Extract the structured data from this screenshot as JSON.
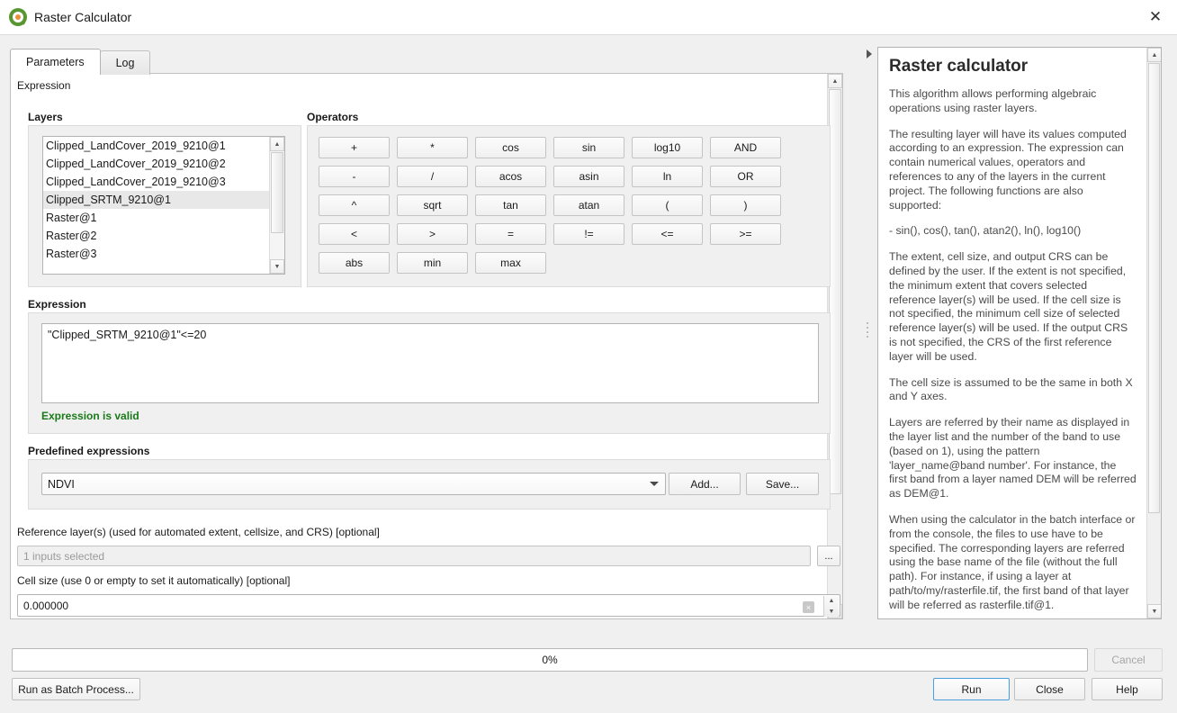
{
  "window": {
    "title": "Raster Calculator",
    "logo_icon": "qgis-logo-icon",
    "close_icon": "✕"
  },
  "tabs": [
    {
      "label": "Parameters",
      "active": true
    },
    {
      "label": "Log",
      "active": false
    }
  ],
  "section_headers": {
    "expression_section": "Expression",
    "layers": "Layers",
    "operators": "Operators",
    "expression": "Expression",
    "predefined": "Predefined expressions"
  },
  "layers": {
    "items": [
      {
        "label": "Clipped_LandCover_2019_9210@1",
        "selected": false
      },
      {
        "label": "Clipped_LandCover_2019_9210@2",
        "selected": false
      },
      {
        "label": "Clipped_LandCover_2019_9210@3",
        "selected": false
      },
      {
        "label": "Clipped_SRTM_9210@1",
        "selected": true
      },
      {
        "label": "Raster@1",
        "selected": false
      },
      {
        "label": "Raster@2",
        "selected": false
      },
      {
        "label": "Raster@3",
        "selected": false
      }
    ]
  },
  "operators": {
    "rows": [
      [
        "+",
        "*",
        "cos",
        "sin",
        "log10",
        "AND"
      ],
      [
        "-",
        "/",
        "acos",
        "asin",
        "ln",
        "OR"
      ],
      [
        "^",
        "sqrt",
        "tan",
        "atan",
        "(",
        ")"
      ],
      [
        "<",
        ">",
        "=",
        "!=",
        "<=",
        ">="
      ],
      [
        "abs",
        "min",
        "max"
      ]
    ]
  },
  "expression": {
    "value": "\"Clipped_SRTM_9210@1\"<=20",
    "validation_text": "Expression is valid",
    "validation_color": "#1a7a1a"
  },
  "predefined": {
    "selected": "NDVI",
    "add_label": "Add...",
    "save_label": "Save..."
  },
  "reference_layers": {
    "label": "Reference layer(s) (used for automated extent, cellsize, and CRS) [optional]",
    "value": "1 inputs selected",
    "browse_label": "..."
  },
  "cell_size": {
    "label": "Cell size (use 0 or empty to set it automatically) [optional]",
    "value": "0.000000",
    "clear_icon": "⌧"
  },
  "help": {
    "title": "Raster calculator",
    "paragraphs": [
      "This algorithm allows performing algebraic operations using raster layers.",
      "The resulting layer will have its values computed according to an expression. The expression can contain numerical values, operators and references to any of the layers in the current project. The following functions are also supported:",
      "- sin(), cos(), tan(), atan2(), ln(), log10()",
      "The extent, cell size, and output CRS can be defined by the user. If the extent is not specified, the minimum extent that covers selected reference layer(s) will be used. If the cell size is not specified, the minimum cell size of selected reference layer(s) will be used. If the output CRS is not specified, the CRS of the first reference layer will be used.",
      "The cell size is assumed to be the same in both X and Y axes.",
      "Layers are referred by their name as displayed in the layer list and the number of the band to use (based on 1), using the pattern 'layer_name@band number'. For instance, the first band from a layer named DEM will be referred as DEM@1.",
      "When using the calculator in the batch interface or from the console, the files to use have to be specified. The corresponding layers are referred using the base name of the file (without the full path). For instance, if using a layer at path/to/my/rasterfile.tif, the first band of that layer will be referred as rasterfile.tif@1."
    ]
  },
  "bottom": {
    "progress_text": "0%",
    "progress_value": 0,
    "cancel_label": "Cancel",
    "batch_label": "Run as Batch Process...",
    "run_label": "Run",
    "close_label": "Close",
    "help_label": "Help"
  }
}
